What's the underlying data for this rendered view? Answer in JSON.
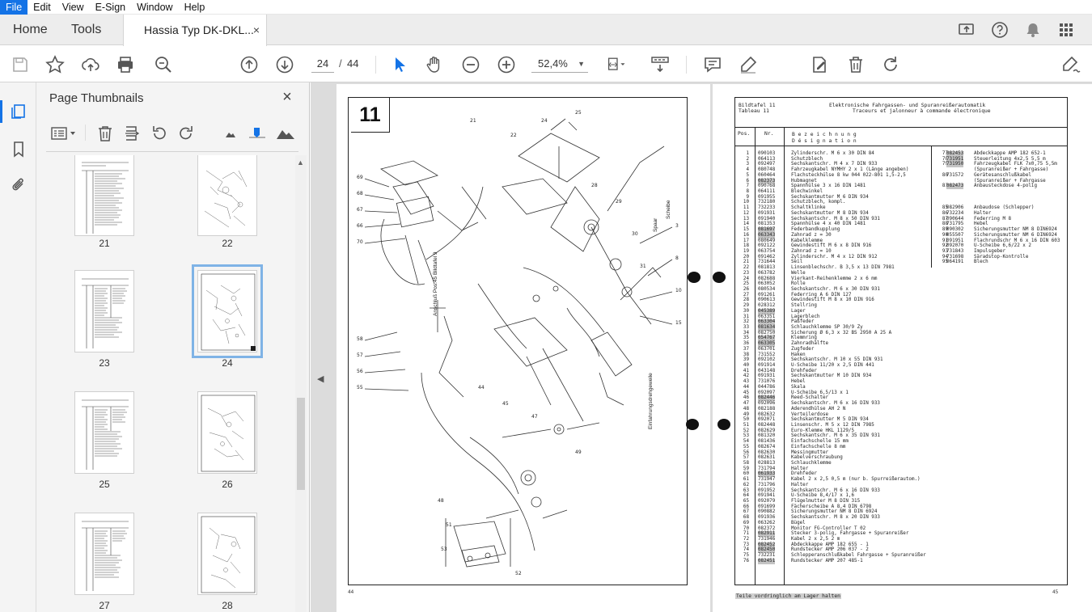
{
  "menu": [
    "File",
    "Edit",
    "View",
    "E-Sign",
    "Window",
    "Help"
  ],
  "tabs": {
    "home": "Home",
    "tools": "Tools",
    "document": "Hassia Typ DK-DKL...",
    "close": "×"
  },
  "toolbar": {
    "current_page": "24",
    "page_separator": "/",
    "total_pages": "44",
    "zoom": "52,4%"
  },
  "panel": {
    "title": "Page Thumbnails",
    "close": "×",
    "thumbnails": [
      {
        "label": "21",
        "kind": "table"
      },
      {
        "label": "22",
        "kind": "drawing"
      },
      {
        "label": "23",
        "kind": "table"
      },
      {
        "label": "24",
        "kind": "drawing",
        "selected": true
      },
      {
        "label": "25",
        "kind": "table"
      },
      {
        "label": "26",
        "kind": "drawing"
      },
      {
        "label": "27",
        "kind": "table"
      },
      {
        "label": "28",
        "kind": "drawing"
      }
    ]
  },
  "left_page": {
    "figure_number": "11",
    "page_number": "44",
    "annotations": [
      "Anschluß Pos.45 Bildtafel 9",
      "Einfahrungsdrehgeweile",
      "Spaar",
      "Scheibe"
    ]
  },
  "right_page": {
    "header": {
      "bildtafel_label": "Bildtafel  11",
      "tableau_label": "Tableau   11",
      "title_de": "Elektronische Fahrgassen- und Spuranreißerautomatik",
      "title_fr": "Traceurs et jalonneur à commande électronique"
    },
    "col_pos": "Pos.",
    "col_nr": "Nr.",
    "col_desc_de": "B e z e i c h n u n g",
    "col_desc_fr": "D é s i g n a t i o n",
    "page_number": "45",
    "footnote": "Teile vordringlich am Lager halten",
    "rows_left": [
      [
        "1",
        "090103",
        "Zylinderschr. M 6 x 30  DIN 84",
        false
      ],
      [
        "2",
        "064113",
        "Schutzblech",
        false
      ],
      [
        "3",
        "092497",
        "Sechskantschr. M 4 x 7 DIN 933",
        false
      ],
      [
        "4",
        "080748",
        "Fahrzeugkabel NYMHY 2 x 1 (Länge angeben)",
        false
      ],
      [
        "5",
        "060464",
        "Flachsteckhülse 8 kw 044 022-801 1,5-2,5",
        false
      ],
      [
        "6",
        "082373",
        "Hubmagnet",
        true
      ],
      [
        "7",
        "090768",
        "Spannhülse 3 x 16  DIN 1481",
        false
      ],
      [
        "8",
        "064111",
        "Blechwinkel",
        false
      ],
      [
        "9",
        "091955",
        "Sechskantmutter M 6  DIN 934",
        false
      ],
      [
        "10",
        "732180",
        "Schutzblech, kompl.",
        false
      ],
      [
        "11",
        "732233",
        "Schaltklinke",
        false
      ],
      [
        "12",
        "091931",
        "Sechskantmutter M 8 DIN 934",
        false
      ],
      [
        "13",
        "091940",
        "Sechskantschr. M 8 x 50  DIN 931",
        false
      ],
      [
        "14",
        "081353",
        "Spannhülse 4 x 40  DIN 1481",
        false
      ],
      [
        "15",
        "081697",
        "Federbandkupplung",
        true
      ],
      [
        "16",
        "063343",
        "Zahnrad z = 30",
        true
      ],
      [
        "17",
        "080649",
        "Kabelklemme",
        false
      ],
      [
        "18",
        "092122",
        "Gewindestift M 6 x 8  DIN 916",
        false
      ],
      [
        "19",
        "063754",
        "Zahnrad z = 10",
        false
      ],
      [
        "20",
        "091462",
        "Zylinderschr. M 4 x 12 DIN 912",
        false
      ],
      [
        "21",
        "731644",
        "Seil",
        false
      ],
      [
        "22",
        "081813",
        "Linsenblechschr. B 3,5 x 13 DIN 7981",
        false
      ],
      [
        "23",
        "063782",
        "Welle",
        false
      ],
      [
        "24",
        "082688",
        "Vierkant-Reihenklemme 2 x 6 mm",
        false
      ],
      [
        "25",
        "063052",
        "Rolle",
        false
      ],
      [
        "26",
        "080534",
        "Sechskantschr. M 6 x 30 DIN 931",
        false
      ],
      [
        "27",
        "091261",
        "Federring A 6  DIN 127",
        false
      ],
      [
        "28",
        "090613",
        "Gewindestift M 8 x 10  DIN 916",
        false
      ],
      [
        "29",
        "028312",
        "Stellring",
        false
      ],
      [
        "30",
        "045389",
        "Lager",
        true
      ],
      [
        "31",
        "063351",
        "Lagerblech",
        false
      ],
      [
        "32",
        "063304",
        "Paßfeder",
        true
      ],
      [
        "33",
        "081634",
        "Schlauchklemme SP 30/9 Zy",
        true
      ],
      [
        "34",
        "082750",
        "Sicherung Ø 6,3 x 32 BS 2950 A 25 A",
        false
      ],
      [
        "35",
        "054767",
        "Klemmring",
        true
      ],
      [
        "36",
        "063305",
        "Zahnradhälfte",
        true
      ],
      [
        "37",
        "063701",
        "Zugfeder",
        false
      ],
      [
        "38",
        "731552",
        "Haken",
        false
      ],
      [
        "39",
        "092102",
        "Sechskantschr. M 10 x 55 DIN 931",
        false
      ],
      [
        "40",
        "091914",
        "U-Scheibe 11/20 x 2,5 DIN 441",
        false
      ],
      [
        "41",
        "043148",
        "Drehfeder",
        false
      ],
      [
        "42",
        "091931",
        "Sechskantmutter M 10  DIN 934",
        false
      ],
      [
        "43",
        "731076",
        "Hebel",
        false
      ],
      [
        "44",
        "044786",
        "Skala",
        false
      ],
      [
        "45",
        "092097",
        "U-Scheibe 6,5/13 x 1",
        false
      ],
      [
        "46",
        "082446",
        "Reed-Schalter",
        true
      ],
      [
        "47",
        "092096",
        "Sechskantschr. M 6 x 16  DIN 933",
        false
      ],
      [
        "48",
        "082188",
        "Aderendhülse AH 2 N",
        false
      ],
      [
        "49",
        "082632",
        "Verteilerdose",
        false
      ],
      [
        "50",
        "092071",
        "Sechskantmutter M 5  DIN 934",
        false
      ],
      [
        "51",
        "082448",
        "Linsenschr. M 5 x 12  DIN 7985",
        false
      ],
      [
        "52",
        "082629",
        "Euro-Klemme HKL 1129/5",
        false
      ],
      [
        "53",
        "081320",
        "Sechskantschr. M 6 x 35 DIN 931",
        false
      ],
      [
        "54",
        "081436",
        "Einfachschelle 15 mm",
        false
      ],
      [
        "55",
        "082674",
        "Einfachschelle  8 mm",
        false
      ],
      [
        "56",
        "082630",
        "Messingmutter",
        false
      ],
      [
        "57",
        "082631",
        "Kabelverschraubung",
        false
      ],
      [
        "58",
        "028813",
        "Schlauchklemme",
        false
      ],
      [
        "59",
        "731794",
        "Halter",
        false
      ],
      [
        "60",
        "061933",
        "Drehfeder",
        true
      ],
      [
        "61",
        "731947",
        "Kabel 2 x 2,5  0,5 m (nur b. Spurreißerautom.)",
        false
      ],
      [
        "62",
        "731796",
        "Halter",
        false
      ],
      [
        "63",
        "091952",
        "Sechskantschr. M 6 x 16  DIN 933",
        false
      ],
      [
        "64",
        "091941",
        "U-Scheibe 8,4/17 x 1,6",
        false
      ],
      [
        "65",
        "092079",
        "Flügelmutter M 8  DIN 315",
        false
      ],
      [
        "66",
        "091699",
        "Fächerscheibe A 8,4 DIN 6798",
        false
      ],
      [
        "67",
        "090882",
        "Sicherungsmutter NM 8  DIN 6924",
        false
      ],
      [
        "68",
        "091936",
        "Sechskantschr. M 8 x 20 DIN 933",
        false
      ],
      [
        "69",
        "063262",
        "Bügel",
        false
      ],
      [
        "70",
        "082372",
        "Monitor FG-Controller T 02",
        false
      ],
      [
        "71",
        "082911",
        "Stecker 3-polig, Fahrgasse + Spuranreißer",
        true
      ],
      [
        "72",
        "731946",
        "Kabel 2 x 2,5  2 m",
        false
      ],
      [
        "73",
        "082452",
        "Abdeckkappe AMP 182  655 - 1",
        true
      ],
      [
        "74",
        "082450",
        "Rundstecker AMP 206  037 - 2",
        true
      ],
      [
        "75",
        "732231",
        "Schlepperanschlußkabel  Fahrgasse + Spuranreißer",
        false
      ],
      [
        "76",
        "082451",
        "Rundstecker AMP 207 485-1",
        true
      ]
    ],
    "rows_right": [
      [
        "77",
        "082453",
        "Abdeckkappe  AMP 182 652-1",
        true
      ],
      [
        "78",
        "731951",
        "Steuerleitung 4x2,5  5,5 m",
        true
      ],
      [
        "79",
        "731950",
        "Fahrzeugkabel FLK 7x0,75 5,5m",
        true
      ],
      [
        "",
        "",
        "(Spuranreißer + Fahrgasse)",
        false
      ],
      [
        "80",
        "731572",
        "Gerätesanschlußkabel",
        false
      ],
      [
        "",
        "",
        "(Spuranreißer + Fahrgasse",
        false
      ],
      [
        "81",
        "082473",
        "Anbausteckdose 4-polig",
        true
      ],
      [
        "",
        "",
        "",
        false
      ],
      [
        "",
        "",
        "",
        false
      ],
      [
        "",
        "",
        "",
        false
      ],
      [
        "85",
        "082906",
        "Anbaudose (Schlepper)",
        false
      ],
      [
        "86",
        "732234",
        "Halter",
        false
      ],
      [
        "87",
        "090644",
        "Federring M 8",
        false
      ],
      [
        "88",
        "731795",
        "Hebel",
        false
      ],
      [
        "89",
        "090302",
        "Sicherungsmutter NM 8 DIN6924",
        false
      ],
      [
        "90",
        "055507",
        "Sicherungsmutter NM 6 DIN6924",
        false
      ],
      [
        "91",
        "091951",
        "Flachrundschr M 6 x 16 DIN 603",
        false
      ],
      [
        "92",
        "092070",
        "U-Scheibe 6,6/22 x 2",
        false
      ],
      [
        "93",
        "731843",
        "Impulsgeber",
        false
      ],
      [
        "94",
        "731698",
        "Säradstop-Kontrolle",
        false
      ],
      [
        "95",
        "064191",
        "Blech",
        false
      ]
    ]
  }
}
